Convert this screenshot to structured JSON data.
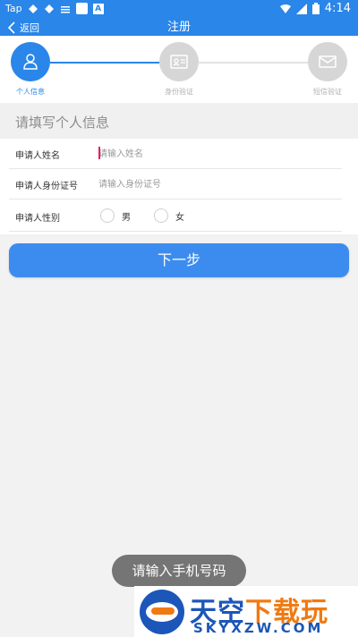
{
  "status_bar": {
    "carrier": "Tap",
    "time": "4:14"
  },
  "titlebar": {
    "back_label": "返回",
    "title": "注册"
  },
  "steps": [
    {
      "label": "个人信息",
      "icon": "person-icon",
      "active": true
    },
    {
      "label": "身份验证",
      "icon": "id-card-icon",
      "active": false
    },
    {
      "label": "短信验证",
      "icon": "envelope-icon",
      "active": false
    }
  ],
  "section": {
    "title": "请填写个人信息"
  },
  "form": {
    "name": {
      "label": "申请人姓名",
      "placeholder": "请输入姓名"
    },
    "id_number": {
      "label": "申请人身份证号",
      "placeholder": "请输入身份证号"
    },
    "gender": {
      "label": "申请人性别",
      "options": [
        "男",
        "女"
      ]
    }
  },
  "next_button": {
    "label": "下一步"
  },
  "toast": {
    "text": "请输入手机号码"
  },
  "watermark": {
    "line1_a": "天空",
    "line1_b": "下载玩",
    "line2": "SKYXZW.COM"
  },
  "colors": {
    "primary": "#2a86e8",
    "button": "#3c8cf0",
    "toast": "#757575",
    "caret": "#e91e63"
  }
}
